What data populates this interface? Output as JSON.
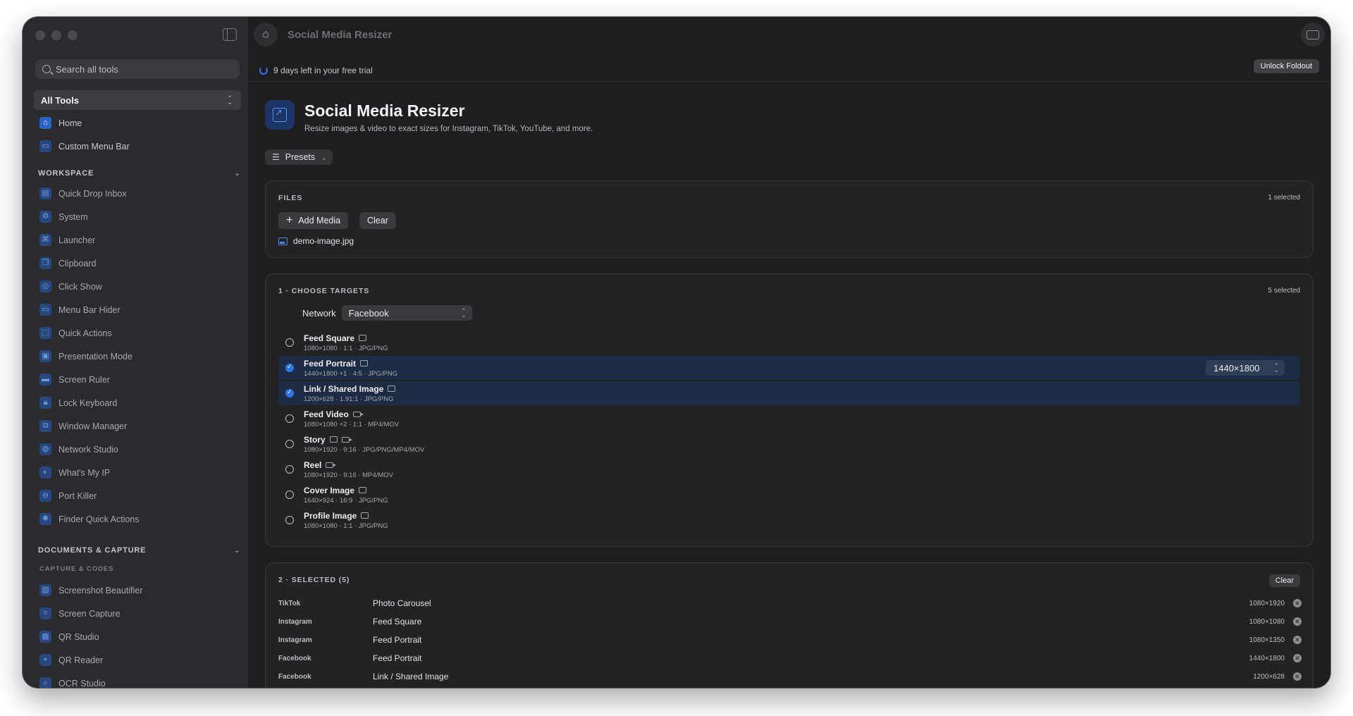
{
  "sidebar": {
    "search_placeholder": "Search all tools",
    "tool_filter": "All Tools",
    "top_items": [
      {
        "label": "Home",
        "icon": "home-icon"
      },
      {
        "label": "Custom Menu Bar",
        "icon": "menu-bar-icon"
      }
    ],
    "workspace": {
      "title": "WORKSPACE",
      "items": [
        {
          "label": "Quick Drop Inbox",
          "icon": "inbox-icon"
        },
        {
          "label": "System",
          "icon": "system-icon"
        },
        {
          "label": "Launcher",
          "icon": "launcher-icon"
        },
        {
          "label": "Clipboard",
          "icon": "clipboard-icon"
        },
        {
          "label": "Click Show",
          "icon": "click-icon"
        },
        {
          "label": "Menu Bar Hider",
          "icon": "menu-bar-icon"
        },
        {
          "label": "Quick Actions",
          "icon": "actions-icon"
        },
        {
          "label": "Presentation Mode",
          "icon": "presentation-icon"
        },
        {
          "label": "Screen Ruler",
          "icon": "ruler-icon"
        },
        {
          "label": "Lock Keyboard",
          "icon": "lock-icon"
        },
        {
          "label": "Window Manager",
          "icon": "window-icon"
        },
        {
          "label": "Network Studio",
          "icon": "network-icon"
        },
        {
          "label": "What's My IP",
          "icon": "globe-icon"
        },
        {
          "label": "Port Killer",
          "icon": "port-icon"
        },
        {
          "label": "Finder Quick Actions",
          "icon": "finder-icon"
        }
      ]
    },
    "documents": {
      "title": "DOCUMENTS & CAPTURE",
      "subtitle": "CAPTURE & CODES",
      "items": [
        {
          "label": "Screenshot Beautifier",
          "icon": "screenshot-icon"
        },
        {
          "label": "Screen Capture",
          "icon": "capture-icon"
        },
        {
          "label": "QR Studio",
          "icon": "qr-icon"
        },
        {
          "label": "QR Reader",
          "icon": "qr-reader-icon"
        },
        {
          "label": "OCR Studio",
          "icon": "ocr-icon"
        }
      ]
    }
  },
  "titlebar": {
    "title": "Social Media Resizer"
  },
  "trial": {
    "text": "9 days left in your free trial",
    "unlock_label": "Unlock Foldout"
  },
  "page": {
    "title": "Social Media Resizer",
    "subtitle": "Resize images & video to exact sizes for Instagram, TikTok, YouTube, and more.",
    "presets_label": "Presets"
  },
  "files": {
    "title": "FILES",
    "count": "1 selected",
    "add_label": "Add Media",
    "clear_label": "Clear",
    "items": [
      {
        "name": "demo-image.jpg"
      }
    ]
  },
  "targets": {
    "title": "1 · CHOOSE TARGETS",
    "count": "5 selected",
    "network_label": "Network",
    "network_value": "Facebook",
    "items": [
      {
        "name": "Feed Square",
        "meta": "1080×1080 · 1:1 · JPG/PNG",
        "selected": false
      },
      {
        "name": "Feed Portrait",
        "meta": "1440×1800 +1 · 4:5 · JPG/PNG",
        "selected": true,
        "size_value": "1440×1800"
      },
      {
        "name": "Link / Shared Image",
        "meta": "1200×628 · 1.91:1 · JPG/PNG",
        "selected": true
      },
      {
        "name": "Feed Video",
        "meta": "1080×1080 +2 · 1:1 · MP4/MOV",
        "selected": false
      },
      {
        "name": "Story",
        "meta": "1080×1920 · 9:16 · JPG/PNG/MP4/MOV",
        "selected": false
      },
      {
        "name": "Reel",
        "meta": "1080×1920 · 9:16 · MP4/MOV",
        "selected": false
      },
      {
        "name": "Cover Image",
        "meta": "1640×924 · 16:9 · JPG/PNG",
        "selected": false
      },
      {
        "name": "Profile Image",
        "meta": "1080×1080 · 1:1 · JPG/PNG",
        "selected": false
      }
    ]
  },
  "selected": {
    "title": "2 · SELECTED (5)",
    "clear_label": "Clear",
    "items": [
      {
        "network": "TikTok",
        "name": "Photo Carousel",
        "size": "1080×1920"
      },
      {
        "network": "Instagram",
        "name": "Feed Square",
        "size": "1080×1080"
      },
      {
        "network": "Instagram",
        "name": "Feed Portrait",
        "size": "1080×1350"
      },
      {
        "network": "Facebook",
        "name": "Feed Portrait",
        "size": "1440×1800"
      },
      {
        "network": "Facebook",
        "name": "Link / Shared Image",
        "size": "1200×628"
      }
    ]
  }
}
